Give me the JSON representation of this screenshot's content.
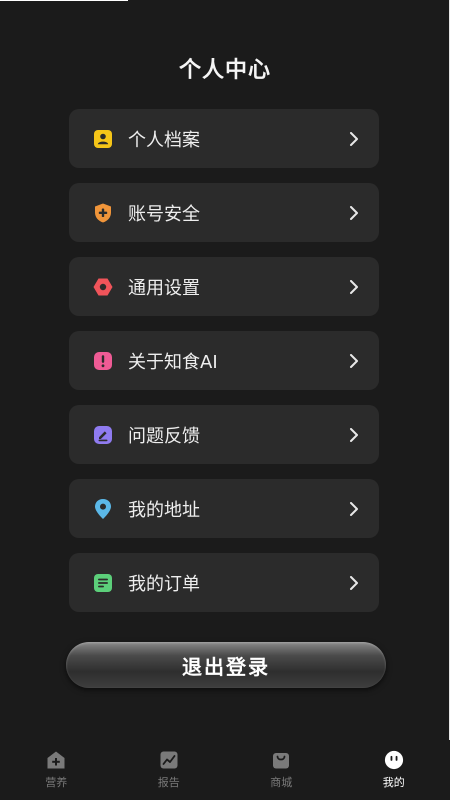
{
  "header": {
    "title": "个人中心"
  },
  "menu": [
    {
      "name": "profile",
      "label": "个人档案",
      "icon": "id-card-icon",
      "color": "#f5c518"
    },
    {
      "name": "account-security",
      "label": "账号安全",
      "icon": "shield-plus-icon",
      "color": "#f0953a"
    },
    {
      "name": "general-settings",
      "label": "通用设置",
      "icon": "gear-hexagon-icon",
      "color": "#f0545a"
    },
    {
      "name": "about",
      "label": "关于知食AI",
      "icon": "exclamation-icon",
      "color": "#ef5b95"
    },
    {
      "name": "feedback",
      "label": "问题反馈",
      "icon": "edit-icon",
      "color": "#8f7bf0"
    },
    {
      "name": "address",
      "label": "我的地址",
      "icon": "location-pin-icon",
      "color": "#5bb8e8"
    },
    {
      "name": "orders",
      "label": "我的订单",
      "icon": "list-doc-icon",
      "color": "#5ccf7a"
    }
  ],
  "logout": {
    "label": "退出登录"
  },
  "tabbar": [
    {
      "name": "nutrition",
      "label": "营养",
      "icon": "home-plus-icon",
      "active": false
    },
    {
      "name": "report",
      "label": "报告",
      "icon": "chart-icon",
      "active": false
    },
    {
      "name": "mall",
      "label": "商城",
      "icon": "shopping-bag-icon",
      "active": false
    },
    {
      "name": "mine",
      "label": "我的",
      "icon": "face-icon",
      "active": true
    }
  ]
}
